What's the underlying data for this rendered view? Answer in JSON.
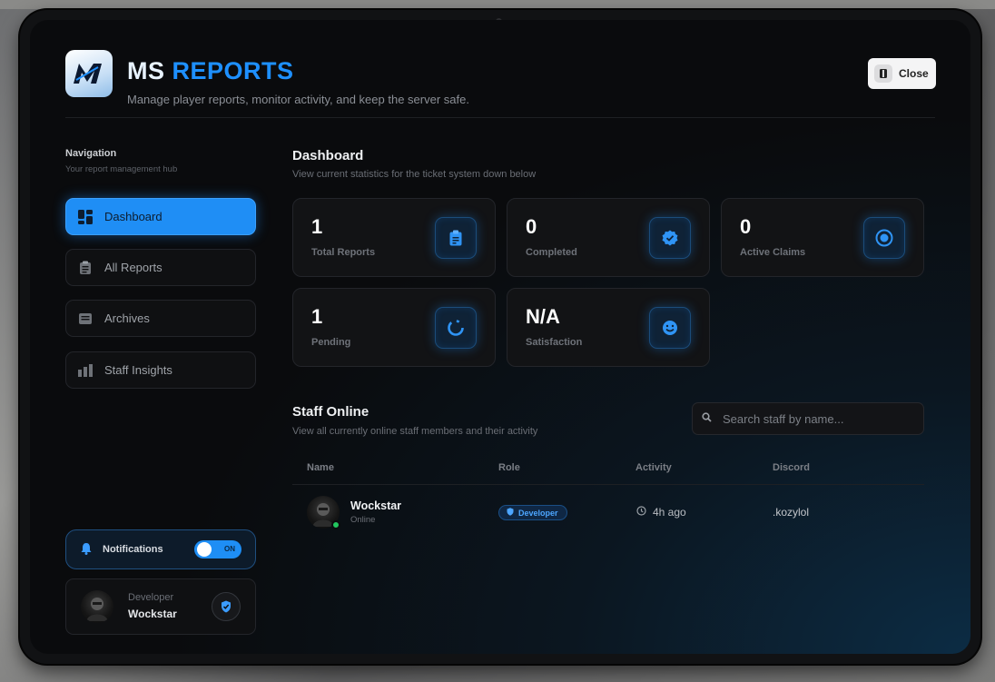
{
  "header": {
    "title_main": "MS",
    "title_accent": "REPORTS",
    "subtitle": "Manage player reports, monitor activity, and keep the server safe.",
    "close_label": "Close"
  },
  "sidebar": {
    "heading": "Navigation",
    "subheading": "Your report management hub",
    "items": [
      {
        "label": "Dashboard",
        "icon": "dashboard-icon",
        "active": true
      },
      {
        "label": "All Reports",
        "icon": "clipboard-list-icon",
        "active": false
      },
      {
        "label": "Archives",
        "icon": "archive-icon",
        "active": false
      },
      {
        "label": "Staff Insights",
        "icon": "bar-chart-icon",
        "active": false
      }
    ],
    "notifications": {
      "label": "Notifications",
      "toggle_text": "ON",
      "enabled": true
    },
    "profile": {
      "role": "Developer",
      "name": "Wockstar"
    }
  },
  "dashboard": {
    "title": "Dashboard",
    "subtitle": "View current statistics for the ticket system down below",
    "cards": [
      {
        "value": "1",
        "label": "Total Reports",
        "icon": "clipboard-icon"
      },
      {
        "value": "0",
        "label": "Completed",
        "icon": "verified-badge-icon"
      },
      {
        "value": "0",
        "label": "Active Claims",
        "icon": "radio-target-icon"
      },
      {
        "value": "1",
        "label": "Pending",
        "icon": "loading-circle-icon"
      },
      {
        "value": "N/A",
        "label": "Satisfaction",
        "icon": "smile-icon"
      }
    ]
  },
  "staff": {
    "title": "Staff Online",
    "subtitle": "View all currently online staff members and their activity",
    "search_placeholder": "Search staff by name...",
    "columns": [
      "Name",
      "Role",
      "Activity",
      "Discord"
    ],
    "rows": [
      {
        "name": "Wockstar",
        "status": "Online",
        "role": "Developer",
        "activity": "4h ago",
        "discord": ".kozylol"
      }
    ]
  },
  "colors": {
    "accent": "#1e90ff",
    "online": "#22c55e",
    "background": "#0a0b0d"
  }
}
